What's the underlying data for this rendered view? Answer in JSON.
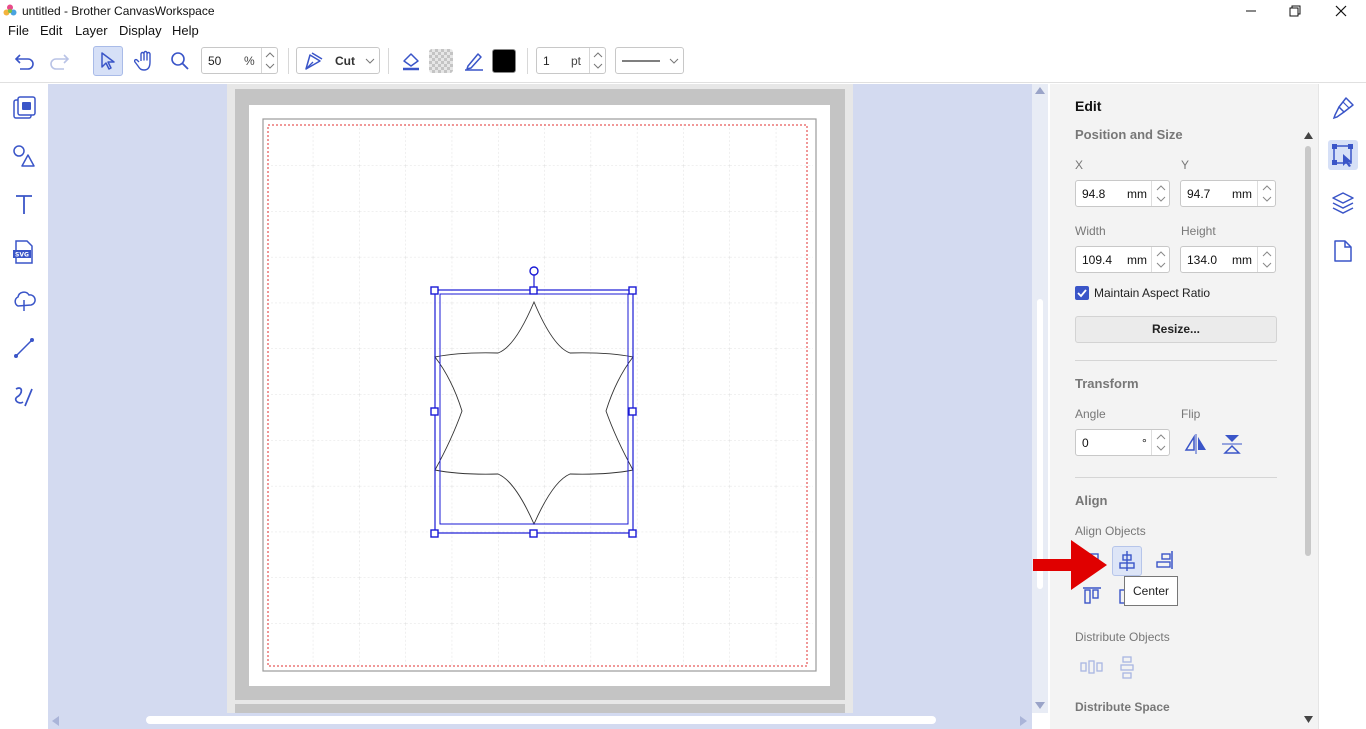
{
  "window": {
    "title": "untitled - Brother CanvasWorkspace"
  },
  "menu": {
    "items": [
      "File",
      "Edit",
      "Layer",
      "Display",
      "Help"
    ]
  },
  "toolbar": {
    "zoom_value": "50",
    "zoom_unit": "%",
    "mode_label": "Cut",
    "line_width_value": "1",
    "line_width_unit": "pt",
    "stroke_color": "#000000"
  },
  "edit_panel": {
    "title": "Edit",
    "position_and_size": "Position and Size",
    "x_label": "X",
    "x_value": "94.8",
    "y_label": "Y",
    "y_value": "94.7",
    "width_label": "Width",
    "width_value": "109.4",
    "height_label": "Height",
    "height_value": "134.0",
    "unit_mm": "mm",
    "maintain_aspect_ratio": "Maintain Aspect Ratio",
    "maintain_aspect_ratio_checked": true,
    "resize_button": "Resize...",
    "transform": "Transform",
    "angle_label": "Angle",
    "angle_value": "0",
    "angle_unit": "°",
    "flip_label": "Flip",
    "align": "Align",
    "align_objects": "Align Objects",
    "distribute_objects": "Distribute Objects",
    "distribute_space": "Distribute Space",
    "tooltip": "Center"
  },
  "colors": {
    "accent": "#3a55c8",
    "canvas_bg": "#d3daf0",
    "selection": "#1a1ad6",
    "cut_margin": "#e03030",
    "arrow": "#e00000"
  }
}
